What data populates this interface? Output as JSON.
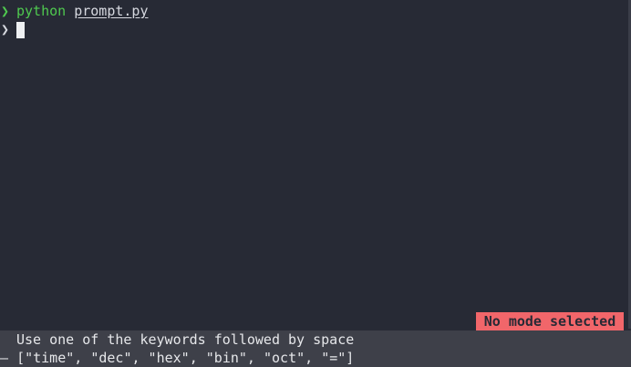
{
  "colors": {
    "background": "#272a35",
    "prompt_chevron": "#4fc94f",
    "command_name": "#4fc94f",
    "text": "#d6d8df",
    "cursor": "#eef0f2",
    "badge_background": "#f1666a",
    "badge_text": "#272a35",
    "footer_background": "#3e4049",
    "footer_text": "#e6e7ea"
  },
  "terminal": {
    "history": {
      "chevron": "❯",
      "command": "python",
      "argument": "prompt.py"
    },
    "current": {
      "chevron": "❯"
    }
  },
  "status": {
    "mode_badge": "No mode selected"
  },
  "footer": {
    "hint": "Use one of the keywords followed by space",
    "options_prefix": "– ",
    "options": "[\"time\", \"dec\", \"hex\", \"bin\", \"oct\", \"=\"]"
  }
}
